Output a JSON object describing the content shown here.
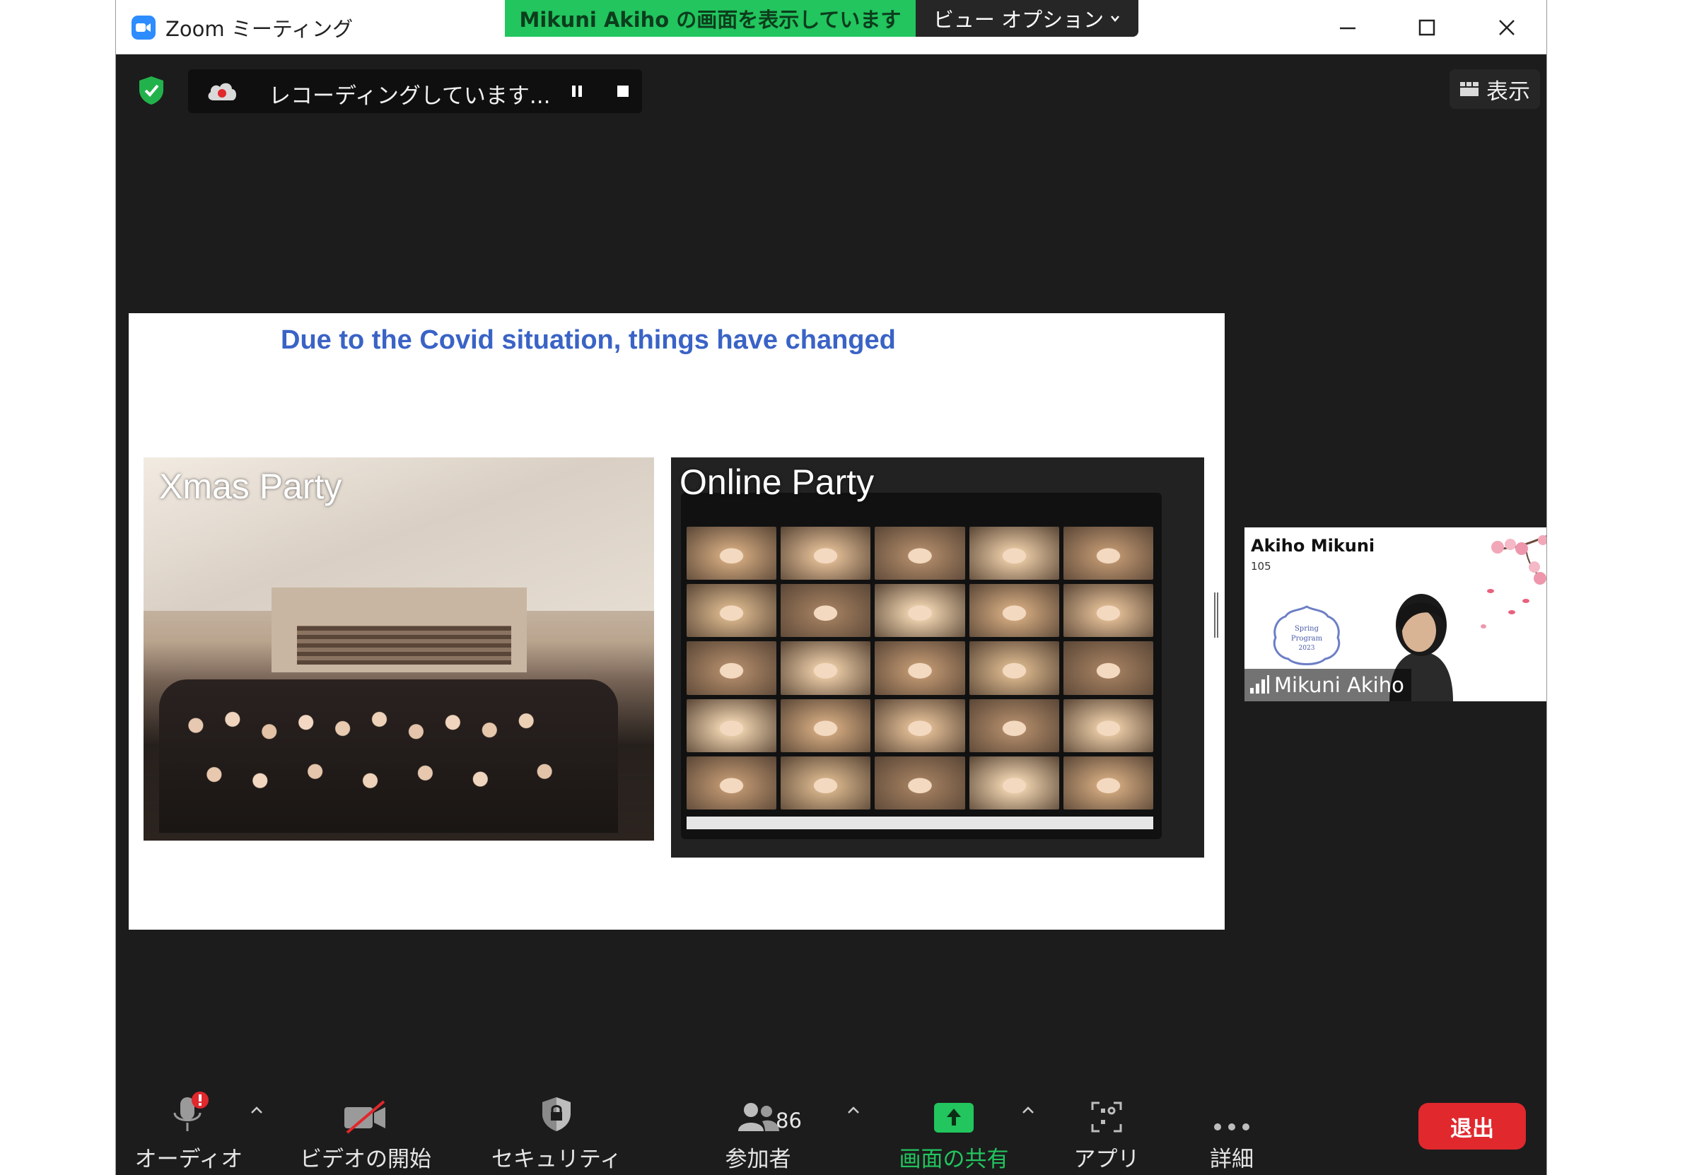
{
  "window": {
    "title": "Zoom ミーティング",
    "share_banner": "Mikuni Akiho の画面を表示しています",
    "view_options": "ビュー オプション"
  },
  "topbar": {
    "recording_text": "レコーディングしています...",
    "view_label": "表示"
  },
  "slide": {
    "title": "Due to the Covid situation, things have changed",
    "photo_left_label": "Xmas Party",
    "photo_right_label": "Online Party"
  },
  "self_view": {
    "header_name": "Akiho Mikuni",
    "header_sub": "105",
    "name_tag": "Mikuni Akiho",
    "badge_line1": "Spring",
    "badge_line2": "Program",
    "badge_line3": "2023"
  },
  "toolbar": {
    "audio_label": "オーディオ",
    "video_label": "ビデオの開始",
    "security_label": "セキュリティ",
    "participants_label": "参加者",
    "participants_count": "86",
    "share_label": "画面の共有",
    "apps_label": "アプリ",
    "more_label": "詳細",
    "leave_label": "退出"
  },
  "colors": {
    "share_green": "#22c55e",
    "leave_red": "#e0282d",
    "slide_title_blue": "#3a63c6",
    "zoom_blue": "#2d8cff"
  }
}
